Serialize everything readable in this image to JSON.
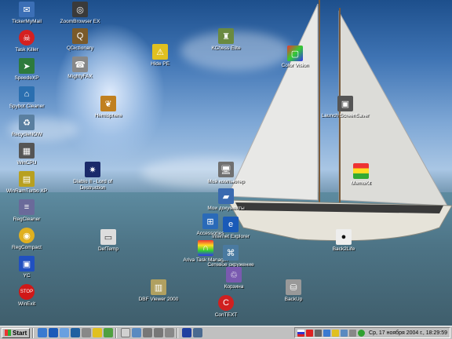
{
  "desktop_icons": {
    "tickermymail": "TickerMyMail",
    "zoombrowser": "ZoomBrowser EX",
    "qdictionary": "QDictionary",
    "taskkiller": "Task Killer",
    "speedexp": "SpeedeXP",
    "mightyfax": "MightyFAX",
    "hidepe": "Hide PE",
    "kchess": "KChess Elite",
    "colorvision": "Color Vision",
    "spybotcleaner": "Spybot Cleaner",
    "hemisphere": "Hemisphere",
    "launchscreensaver": "Launch ScreenSaver",
    "recyclenow": "RecycleNOW",
    "wincpu": "WinCPU",
    "winramturbo": "WinRamTurbo XP",
    "lod": "Diablo II - Lord of Destruction",
    "mycomputer": "Мой компьютер",
    "mydocuments": "Мои документы",
    "memokit": "MemoKit",
    "regcleaner": "RegCleaner",
    "accessories": "Accessories",
    "ie": "Internet Explorer",
    "regcompact": "RegCompact",
    "deftemp": "DefTemp",
    "back2life": "Back2Life",
    "arivatask": "Ariva Task Manager",
    "network": "Сетевое окружение",
    "yc": "YC",
    "recyclebin": "Корзина",
    "winexit": "WinExit",
    "dbfviewer": "DBF Viewer 2000",
    "backup": "BackUp",
    "context": "ConTEXT"
  },
  "taskbar": {
    "start_label": "Start",
    "clock": "Ср, 17 ноября 2004 г., 18:29:59"
  },
  "colors": {
    "taskbar": "#c0c0c0",
    "sky_top": "#1d4f8c",
    "sea": "#4d7486"
  }
}
